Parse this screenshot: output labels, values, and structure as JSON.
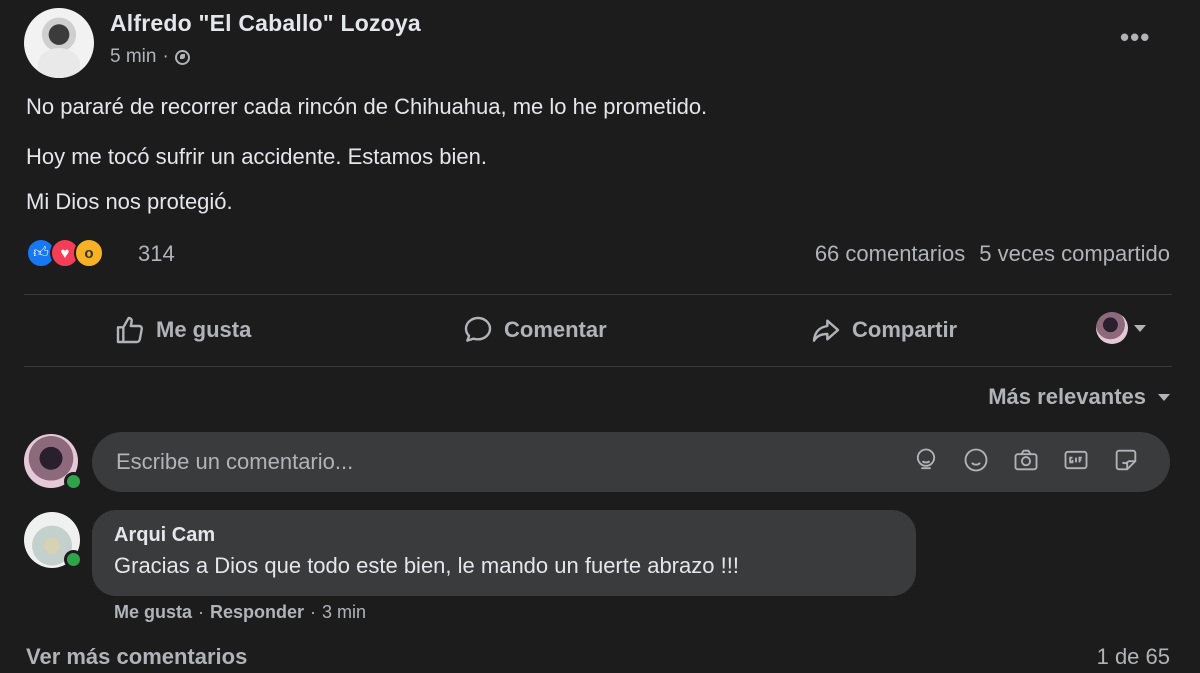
{
  "post": {
    "author": "Alfredo \"El Caballo\" Lozoya",
    "time": "5 min",
    "separator": "·",
    "lines": [
      "No pararé de recorrer cada rincón de Chihuahua, me lo he prometido.",
      "Hoy me tocó sufrir un accidente. Estamos bien.",
      "Mi Dios nos protegió."
    ],
    "more_icon": "•••"
  },
  "stats": {
    "reactions_count": "314",
    "reaction_types": [
      "like",
      "love",
      "wow"
    ],
    "comments": "66 comentarios",
    "shares": "5 veces compartido"
  },
  "actions": {
    "like": "Me gusta",
    "comment": "Comentar",
    "share": "Compartir"
  },
  "comments_section": {
    "sort_label": "Más relevantes",
    "input_placeholder": "Escribe un comentario...",
    "comment": {
      "name": "Arqui Cam",
      "text": "Gracias a Dios que todo este bien, le mando un fuerte abrazo !!!",
      "like": "Me gusta",
      "reply": "Responder",
      "time": "3 min",
      "separator": "·"
    },
    "more_comments": "Ver más comentarios",
    "page_count": "1 de 65"
  },
  "colors": {
    "background": "#1c1c1d",
    "bubble": "#3a3b3c",
    "text_primary": "#e4e6eb",
    "text_secondary": "#b0b3b8",
    "like_blue": "#1877f2",
    "love_red": "#f33e58",
    "wow_yellow": "#f7b125",
    "online_green": "#31a24c"
  }
}
